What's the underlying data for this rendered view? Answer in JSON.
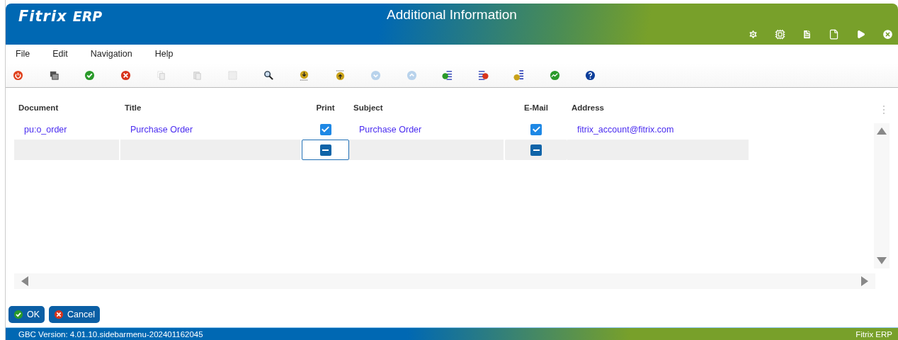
{
  "window": {
    "logo": "Fitrix",
    "logo_suffix": "ERP",
    "title": "Additional Information"
  },
  "menu": [
    "File",
    "Edit",
    "Navigation",
    "Help"
  ],
  "table": {
    "columns": [
      "Document",
      "Title",
      "Print",
      "Subject",
      "E-Mail",
      "Address"
    ],
    "rows": [
      {
        "selected": false,
        "document": "pu:o_order",
        "title": "Purchase Order",
        "print": {
          "checked": true
        },
        "subject": "Purchase Order",
        "email": {
          "checked": true
        },
        "address": "fitrix_account@fitrix.com"
      },
      {
        "selected": true,
        "print": {
          "indeterminate": true,
          "focused": true
        },
        "email": {
          "indeterminate": true
        }
      }
    ]
  },
  "buttons": [
    {
      "label": "OK",
      "kind": "ok"
    },
    {
      "label": "Cancel",
      "kind": "cancel"
    }
  ],
  "status_bar": {
    "left": "GBC Version: 4.01.10.sidebarmenu-202401162045",
    "right": "Fitrix ERP"
  }
}
